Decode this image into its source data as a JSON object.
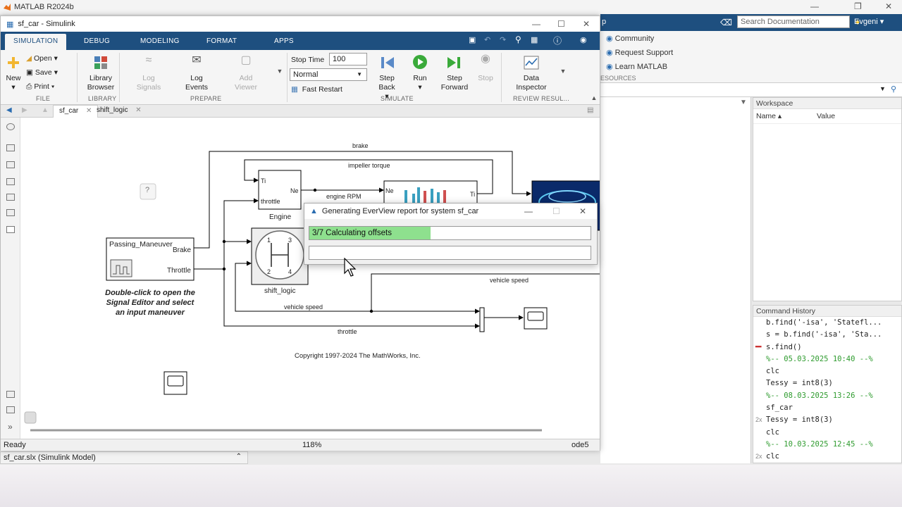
{
  "matlab": {
    "title": "MATLAB R2024b",
    "search_placeholder": "Search Documentation",
    "user": "Evgeni",
    "resources": [
      "Community",
      "Request Support",
      "Learn MATLAB"
    ],
    "resources_label": "ESOURCES",
    "workspace": {
      "title": "Workspace",
      "col_name": "Name ▴",
      "col_value": "Value"
    },
    "command_history": {
      "title": "Command History",
      "lines": [
        {
          "text": "b.find('-isa', 'Statefl...",
          "mark": "",
          "sep": false
        },
        {
          "text": "s = b.find('-isa', 'Sta...",
          "mark": "",
          "sep": false
        },
        {
          "text": "s.find()",
          "mark": "━",
          "sep": false
        },
        {
          "text": "%-- 05.03.2025 10:40 --%",
          "mark": "",
          "sep": true
        },
        {
          "text": "clc",
          "mark": "",
          "sep": false
        },
        {
          "text": "Tessy = int8(3)",
          "mark": "",
          "sep": false
        },
        {
          "text": "%-- 08.03.2025 13:26 --%",
          "mark": "",
          "sep": true
        },
        {
          "text": "sf_car",
          "mark": "",
          "sep": false
        },
        {
          "text": "Tessy = int8(3)",
          "mark": "2x",
          "sep": false
        },
        {
          "text": "clc",
          "mark": "",
          "sep": false
        },
        {
          "text": "%-- 10.03.2025 12:45 --%",
          "mark": "",
          "sep": true
        },
        {
          "text": "clc",
          "mark": "2x",
          "sep": false
        }
      ]
    },
    "file_bar": "sf_car.slx  (Simulink Model)"
  },
  "simulink": {
    "title": "sf_car - Simulink",
    "tabs": [
      "SIMULATION",
      "DEBUG",
      "MODELING",
      "FORMAT",
      "APPS"
    ],
    "file": {
      "new": "New",
      "open": "Open",
      "save": "Save",
      "print": "Print",
      "section": "FILE"
    },
    "library": {
      "browser": "Library Browser",
      "section": "LIBRARY"
    },
    "prepare": {
      "log_signals": "Log Signals",
      "log_events": "Log Events",
      "add_viewer": "Add Viewer",
      "section": "PREPARE"
    },
    "simulate": {
      "stop_time_label": "Stop Time",
      "stop_time_value": "100",
      "mode": "Normal",
      "fast_restart": "Fast Restart",
      "step_back": "Step Back",
      "run": "Run",
      "step_forward": "Step Forward",
      "stop": "Stop",
      "section": "SIMULATE"
    },
    "review": {
      "data_inspector": "Data Inspector",
      "section": "REVIEW RESUL..."
    },
    "doc_tabs": [
      "sf_car",
      "shift_logic"
    ],
    "status": {
      "state": "Ready",
      "zoom": "118%",
      "solver": "ode5"
    }
  },
  "model": {
    "signals": {
      "brake": "brake",
      "impeller": "impeller torque",
      "engine_rpm": "engine RPM",
      "vehicle_speed_top": "vehicle speed",
      "vehicle_speed": "vehicle speed",
      "throttle": "throttle"
    },
    "engine": {
      "name": "Engine",
      "in_ti": "Ti",
      "in_throttle": "throttle",
      "out_ne": "Ne"
    },
    "trans": {
      "in_ne": "Ne",
      "out_ti": "Ti"
    },
    "passing": {
      "name": "Passing_Maneuver",
      "brake": "Brake",
      "throttle": "Throttle"
    },
    "instructions": "Double-click to open the Signal Editor and select an input maneuver",
    "shift": {
      "name": "shift_logic",
      "g1": "1",
      "g2": "2",
      "g3": "3",
      "g4": "4"
    },
    "help_glyph": "?",
    "copyright": "Copyright 1997-2024 The MathWorks, Inc."
  },
  "dialog": {
    "title": "Generating EverView report for system sf_car",
    "progress_text": "3/7 Calculating offsets",
    "progress_fraction": 0.43,
    "progress2_fraction": 0
  },
  "colors": {
    "ribbon_blue": "#1e4f7f",
    "progress_green": "#8ee08e",
    "history_green": "#2e9b2e"
  }
}
